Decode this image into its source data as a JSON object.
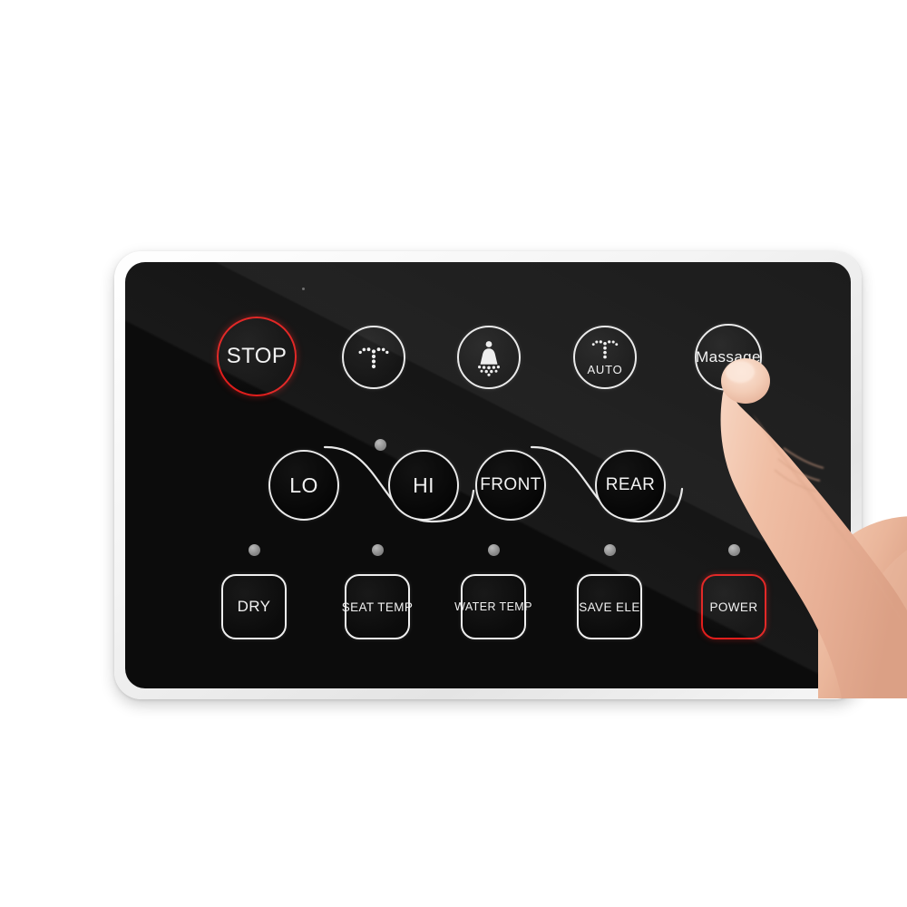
{
  "device": {
    "type": "smart-toilet-bidet-remote-control-panel",
    "bezel_color": "#f2f2f2",
    "glass_color": "#070707",
    "accent_red": "#e01a18",
    "label_color": "#f2f2f2",
    "led_color": "#8a8a8a"
  },
  "rows": {
    "row1": {
      "buttons": [
        {
          "name": "stop",
          "label": "STOP",
          "icon": "none",
          "shape": "circle",
          "accent": "red",
          "size": 88
        },
        {
          "name": "rear-wash",
          "label": "",
          "icon": "rear-spray-icon",
          "shape": "circle",
          "accent": "white",
          "size": 70
        },
        {
          "name": "front-wash",
          "label": "",
          "icon": "lady-wash-icon",
          "shape": "circle",
          "accent": "white",
          "size": 70
        },
        {
          "name": "auto-wash",
          "label": "AUTO",
          "icon": "auto-spray-icon",
          "shape": "circle",
          "accent": "white",
          "size": 70
        },
        {
          "name": "massage",
          "label": "Massage",
          "icon": "none",
          "shape": "circle",
          "accent": "white",
          "size": 72
        }
      ]
    },
    "row2": {
      "pairs": [
        {
          "name": "pressure",
          "left": "LO",
          "right": "HI",
          "connector": "s-curve",
          "led": true
        },
        {
          "name": "position",
          "left": "FRONT",
          "right": "REAR",
          "connector": "s-curve",
          "led": false
        }
      ]
    },
    "row3": {
      "buttons": [
        {
          "name": "dry",
          "label": "DRY",
          "accent": "white",
          "led": true
        },
        {
          "name": "seat-temp",
          "label": "SEAT TEMP",
          "accent": "white",
          "led": true
        },
        {
          "name": "water-temp",
          "label": "WATER TEMP",
          "accent": "white",
          "led": true
        },
        {
          "name": "save-ele",
          "label": "SAVE ELE",
          "accent": "white",
          "led": true
        },
        {
          "name": "power",
          "label": "POWER",
          "accent": "red",
          "led": true
        }
      ]
    }
  },
  "hand": {
    "description": "index-finger-pressing-massage-button",
    "skin_color": "#f0c3a8",
    "target_button": "Massage"
  }
}
